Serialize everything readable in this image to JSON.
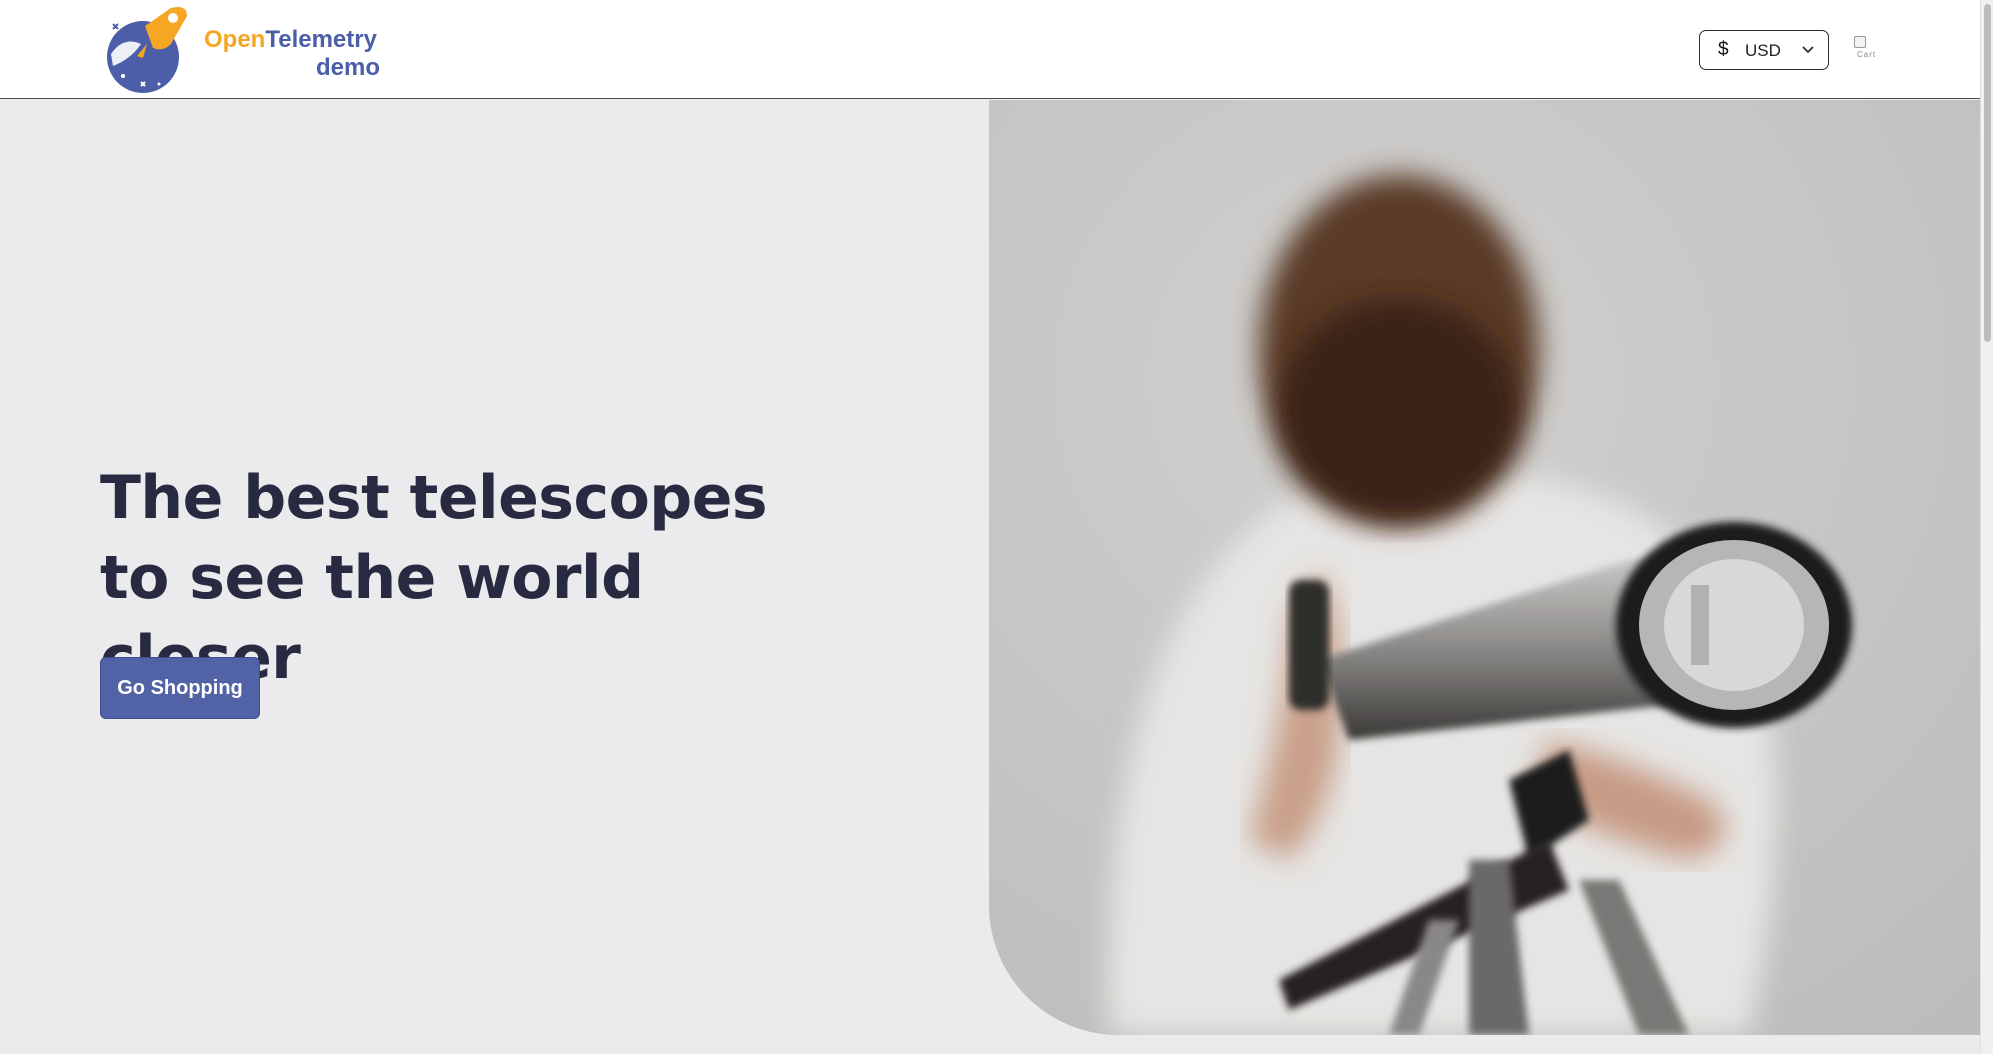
{
  "header": {
    "logo": {
      "word1": "Open",
      "word2": "Telemetry",
      "sub": "demo",
      "icon": "rocket-planet-logo"
    },
    "currency": {
      "symbol": "$",
      "code": "USD",
      "icon": "chevron-down-icon"
    },
    "cart": {
      "icon": "cart-icon",
      "alt_text": "Cart"
    }
  },
  "hero": {
    "title": "The best telescopes to see the world closer",
    "cta_label": "Go Shopping",
    "image": "child-looking-through-telescope-photo"
  },
  "colors": {
    "brand_orange": "#f5a623",
    "brand_blue": "#4d5ea8",
    "cta_bg": "#5262a6",
    "title_text": "#272a40",
    "page_bg": "#ebebed"
  }
}
